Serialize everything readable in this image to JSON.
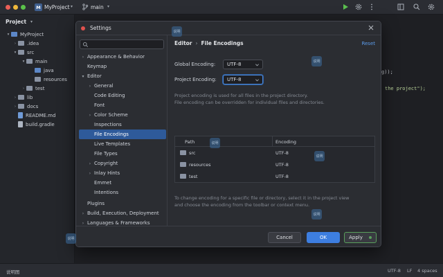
{
  "titlebar": {
    "project_badge": "M",
    "project_name": "MyProject",
    "branch": "main",
    "run_icon": "play-icon",
    "settings_icon": "gear-icon"
  },
  "project_panel": {
    "title": "Project",
    "tree": [
      {
        "label": "MyProject",
        "kind": "root"
      },
      {
        "label": ".idea",
        "kind": "folder"
      },
      {
        "label": "src",
        "kind": "folder"
      },
      {
        "label": "main",
        "kind": "folder"
      },
      {
        "label": "java",
        "kind": "folder"
      },
      {
        "label": "resources",
        "kind": "folder"
      },
      {
        "label": "test",
        "kind": "folder"
      },
      {
        "label": "lib",
        "kind": "folder"
      },
      {
        "label": "docs",
        "kind": "folder"
      },
      {
        "label": "README.md",
        "kind": "file"
      },
      {
        "label": "build.gradle",
        "kind": "file"
      }
    ]
  },
  "editor_fragments": {
    "line1": "g));",
    "line2": "the project\");"
  },
  "dialog": {
    "title": "Settings",
    "search_placeholder": "",
    "nav": [
      {
        "label": "Appearance & Behavior"
      },
      {
        "label": "Keymap"
      },
      {
        "label": "Editor"
      },
      {
        "label": "General"
      },
      {
        "label": "Code Editing"
      },
      {
        "label": "Font"
      },
      {
        "label": "Color Scheme"
      },
      {
        "label": "Inspections"
      },
      {
        "label": "File Encodings"
      },
      {
        "label": "Live Templates"
      },
      {
        "label": "File Types"
      },
      {
        "label": "Copyright"
      },
      {
        "label": "Inlay Hints"
      },
      {
        "label": "Emmet"
      },
      {
        "label": "Intentions"
      },
      {
        "label": "Plugins"
      },
      {
        "label": "Build, Execution, Deployment"
      },
      {
        "label": "Languages & Frameworks"
      }
    ],
    "breadcrumb": {
      "parent": "Editor",
      "separator": "›",
      "current": "File Encodings"
    },
    "reset_label": "Reset",
    "global_encoding": {
      "label": "Global Encoding:",
      "value": "UTF-8"
    },
    "project_encoding": {
      "label": "Project Encoding:",
      "value": "UTF-8"
    },
    "note_top": [
      "Project encoding is used for all files in the project directory.",
      "File encoding can be overridden for individual files and directories."
    ],
    "table": {
      "columns": [
        "Path",
        "Encoding"
      ],
      "rows": [
        {
          "path": "src",
          "encoding": "UTF-8"
        },
        {
          "path": "resources",
          "encoding": "UTF-8"
        },
        {
          "path": "test",
          "encoding": "UTF-8"
        }
      ]
    },
    "note_bottom": [
      "To change encoding for a specific file or directory, select it in the project view",
      "and choose the encoding from the toolbar or context menu."
    ],
    "buttons": {
      "cancel": "Cancel",
      "ok": "OK",
      "apply": "Apply"
    }
  },
  "statusbar": {
    "left": "说明图",
    "encoding": "UTF-8",
    "line_sep": "LF",
    "indent": "4 spaces"
  },
  "colors": {
    "accent": "#3d7ee0",
    "selection": "#2e5a9a",
    "apply_border": "#5aa05c",
    "close_dot": "#e0524e"
  },
  "watermark_text": "说明"
}
